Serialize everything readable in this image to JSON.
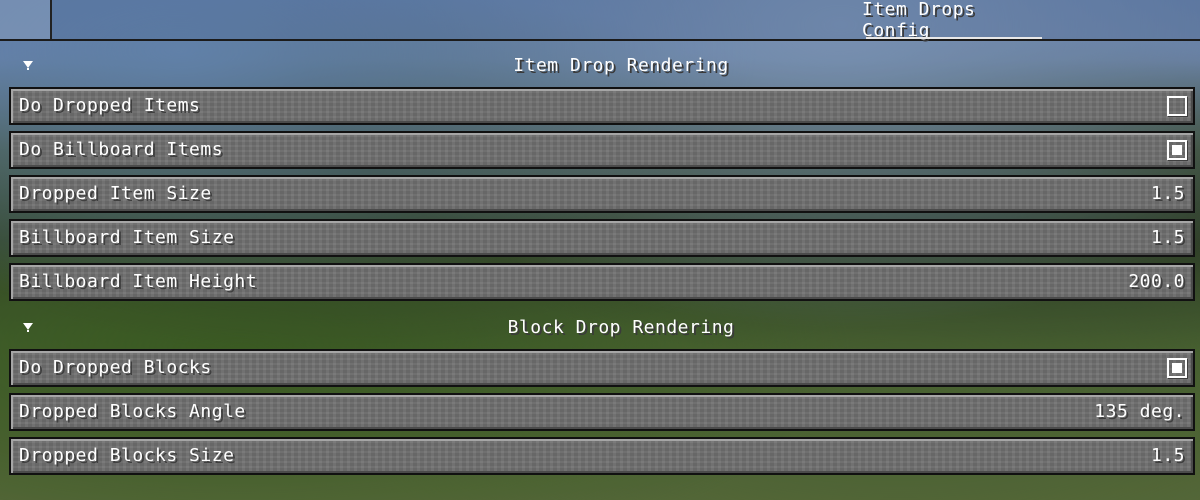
{
  "tabs": {
    "active_label": "Item Drops Config"
  },
  "sections": [
    {
      "title": "Item Drop Rendering",
      "rows": [
        {
          "label": "Do Dropped Items",
          "type": "checkbox",
          "checked": false
        },
        {
          "label": "Do Billboard Items",
          "type": "checkbox",
          "checked": true
        },
        {
          "label": "Dropped Item Size",
          "type": "value",
          "value": "1.5"
        },
        {
          "label": "Billboard Item Size",
          "type": "value",
          "value": "1.5"
        },
        {
          "label": "Billboard Item Height",
          "type": "value",
          "value": "200.0"
        }
      ]
    },
    {
      "title": "Block Drop Rendering",
      "rows": [
        {
          "label": "Do Dropped Blocks",
          "type": "checkbox",
          "checked": true
        },
        {
          "label": "Dropped Blocks Angle",
          "type": "value",
          "value": "135 deg."
        },
        {
          "label": "Dropped Blocks Size",
          "type": "value",
          "value": "1.5"
        }
      ]
    }
  ]
}
